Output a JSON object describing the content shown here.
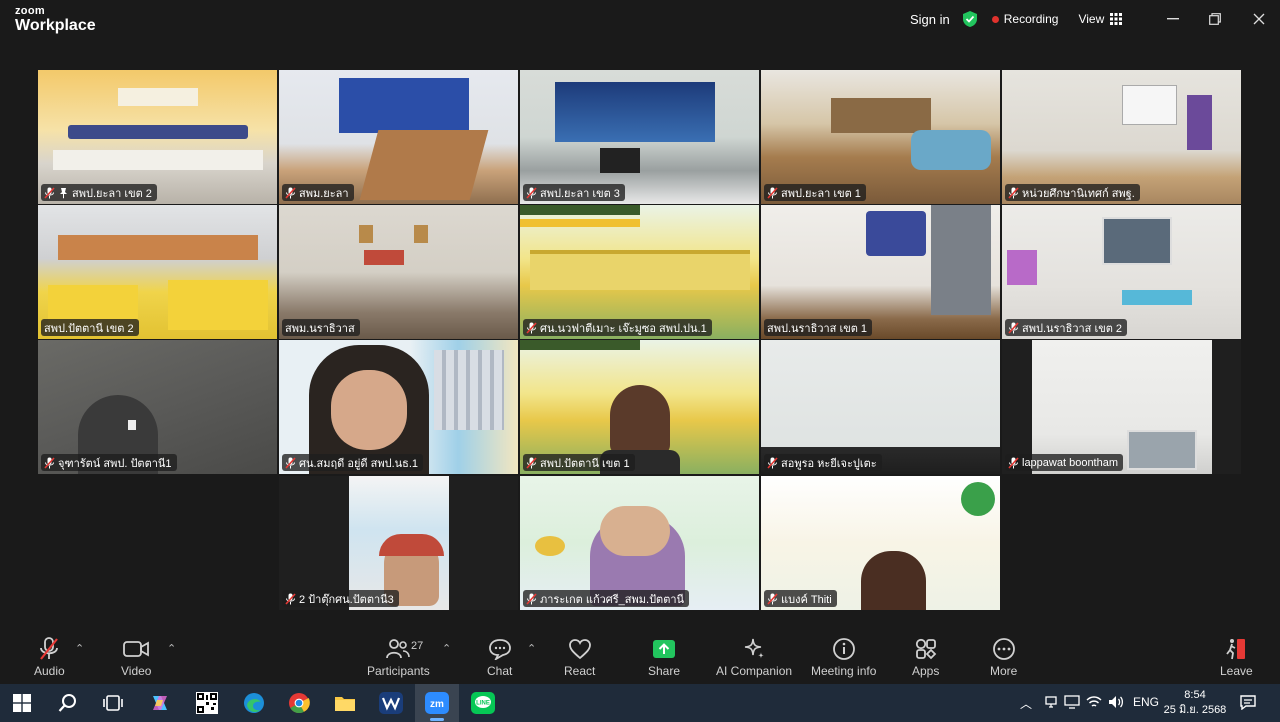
{
  "app": {
    "brand_top": "zoom",
    "brand_bottom": "Workplace"
  },
  "titlebar": {
    "signin": "Sign in",
    "recording": "Recording",
    "view": "View"
  },
  "tiles": [
    {
      "name": "สพป.ยะลา เขต 2",
      "pinned": true
    },
    {
      "name": "สพม.ยะลา"
    },
    {
      "name": "สพป.ยะลา เขต 3"
    },
    {
      "name": "สพป.ยะลา เขต 1"
    },
    {
      "name": "หน่วยศึกษานิเทศก์ สพฐ."
    },
    {
      "name": "สพป.ปัตตานี เขต 2",
      "active": true
    },
    {
      "name": "สพม.นราธิวาส"
    },
    {
      "name": "ศน.นวฟาตีเมาะ เจ๊ะมูซอ สพป.ปน.1"
    },
    {
      "name": "สพป.นราธิวาส เขต 1"
    },
    {
      "name": "สพป.นราธิวาส เขต 2"
    },
    {
      "name": "จุฑารัตน์ สพป. ปัตตานี1"
    },
    {
      "name": "ศน.สมฤดี  อยู่ดี สพป.นธ.1"
    },
    {
      "name": "สพป.ปัตตานี เขต 1"
    },
    {
      "name": "สอพูรอ หะยีเจะปูเตะ"
    },
    {
      "name": "lappawat boontham"
    },
    {
      "name": "2 ป้าตุ๊กศน.ปัตตานี3"
    },
    {
      "name": "ภาระเกต แก้วศรี_สพม.ปัตตานี"
    },
    {
      "name": "แบงค์ Thiti"
    }
  ],
  "toolbar": {
    "audio": "Audio",
    "video": "Video",
    "participants": "Participants",
    "participants_count": "27",
    "chat": "Chat",
    "react": "React",
    "share": "Share",
    "ai": "AI Companion",
    "meeting_info": "Meeting info",
    "apps": "Apps",
    "more": "More",
    "leave": "Leave"
  },
  "taskbar": {
    "lang": "ENG",
    "time": "8:54",
    "date": "25 มิ.ย. 2568"
  },
  "colors": {
    "active_border": "#3ed07a",
    "recording": "#e0322d",
    "share": "#22c55e",
    "leave": "#e53935"
  }
}
